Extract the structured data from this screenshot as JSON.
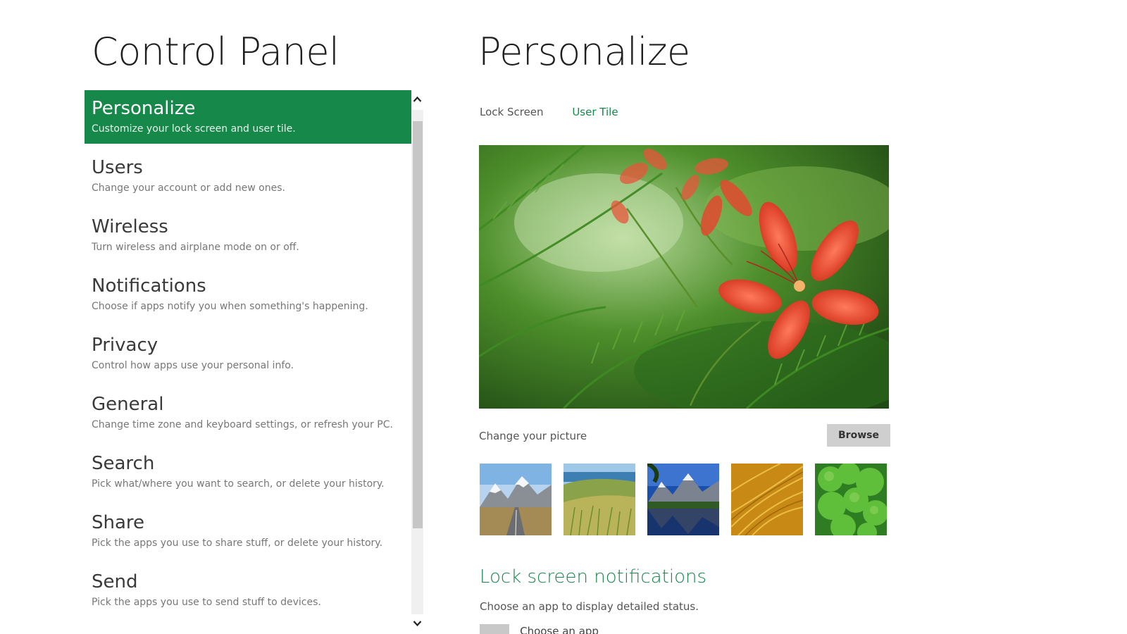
{
  "left_title": "Control Panel",
  "right_title": "Personalize",
  "colors": {
    "accent": "#16884a",
    "selected_bg": "#16884a",
    "scroll_thumb": "#c6c6c6"
  },
  "sidebar": {
    "items": [
      {
        "label": "Personalize",
        "desc": "Customize your lock screen and user tile.",
        "selected": true
      },
      {
        "label": "Users",
        "desc": "Change your account or add new ones."
      },
      {
        "label": "Wireless",
        "desc": "Turn wireless and airplane mode on or off."
      },
      {
        "label": "Notifications",
        "desc": "Choose if apps notify you when something's happening."
      },
      {
        "label": "Privacy",
        "desc": "Control how apps use your personal info."
      },
      {
        "label": "General",
        "desc": "Change time zone and keyboard settings, or refresh your PC."
      },
      {
        "label": "Search",
        "desc": "Pick what/where you want to search, or delete your history."
      },
      {
        "label": "Share",
        "desc": "Pick the apps you use to share stuff, or delete your history."
      },
      {
        "label": "Send",
        "desc": "Pick the apps you use to send stuff to devices."
      }
    ]
  },
  "tabs": [
    {
      "label": "Lock Screen",
      "active": false
    },
    {
      "label": "User Tile",
      "active": true
    }
  ],
  "main": {
    "change_picture_label": "Change your picture",
    "browse_label": "Browse",
    "thumbnails": [
      "mountain-road",
      "grassy-hills",
      "mountain-lake",
      "golden-grass",
      "clover"
    ],
    "section_heading": "Lock screen notifications",
    "section_desc": "Choose an app to display detailed status.",
    "choose_app_label": "Choose an app"
  },
  "icons": {
    "scroll_up": "chevron-up-icon",
    "scroll_down": "chevron-down-icon"
  }
}
